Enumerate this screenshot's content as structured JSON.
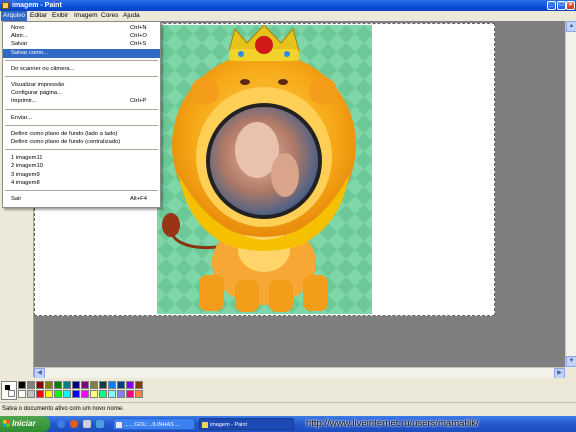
{
  "window": {
    "title": "imagem - Paint"
  },
  "menubar": [
    "Arquivo",
    "Editar",
    "Exibir",
    "Imagem",
    "Cores",
    "Ajuda"
  ],
  "file_menu": {
    "groups": [
      [
        {
          "label": "Novo",
          "shortcut": "Ctrl+N"
        },
        {
          "label": "Abrir...",
          "shortcut": "Ctrl+O"
        },
        {
          "label": "Salvar",
          "shortcut": "Ctrl+S"
        },
        {
          "label": "Salvar como...",
          "shortcut": "",
          "highlighted": true
        }
      ],
      [
        {
          "label": "Do scanner ou câmera...",
          "shortcut": ""
        }
      ],
      [
        {
          "label": "Visualizar impressão",
          "shortcut": ""
        },
        {
          "label": "Configurar página...",
          "shortcut": ""
        },
        {
          "label": "Imprimir...",
          "shortcut": "Ctrl+P"
        }
      ],
      [
        {
          "label": "Enviar...",
          "shortcut": ""
        }
      ],
      [
        {
          "label": "Definir como plano de fundo (lado a lado)",
          "shortcut": ""
        },
        {
          "label": "Definir como plano de fundo (centralizado)",
          "shortcut": ""
        }
      ],
      [
        {
          "label": "1 imagem11",
          "shortcut": ""
        },
        {
          "label": "2 imagem10",
          "shortcut": ""
        },
        {
          "label": "3 imagem9",
          "shortcut": ""
        },
        {
          "label": "4 imagem8",
          "shortcut": ""
        }
      ],
      [
        {
          "label": "Sair",
          "shortcut": "Alt+F4"
        }
      ]
    ]
  },
  "palette": {
    "foreground": "#000000",
    "background": "#ffffff",
    "colors_top": [
      "#000000",
      "#808080",
      "#800000",
      "#808000",
      "#008000",
      "#008080",
      "#000080",
      "#800080",
      "#808040",
      "#004040",
      "#0080ff",
      "#004080",
      "#8000ff",
      "#804000"
    ],
    "colors_bottom": [
      "#ffffff",
      "#c0c0c0",
      "#ff0000",
      "#ffff00",
      "#00ff00",
      "#00ffff",
      "#0000ff",
      "#ff00ff",
      "#ffff80",
      "#00ff80",
      "#80ffff",
      "#8080ff",
      "#ff0080",
      "#ff8040"
    ]
  },
  "statusbar": {
    "text": "Salva o documento ativo com um novo nome."
  },
  "taskbar": {
    "start_label": "Iniciar",
    "tasks": [
      {
        "label": "......:GOL:...ILINHAS ..."
      },
      {
        "label": "imagem - Paint"
      }
    ],
    "watermark": "http://www.liveinternet.ru/users/mamatiik/"
  }
}
